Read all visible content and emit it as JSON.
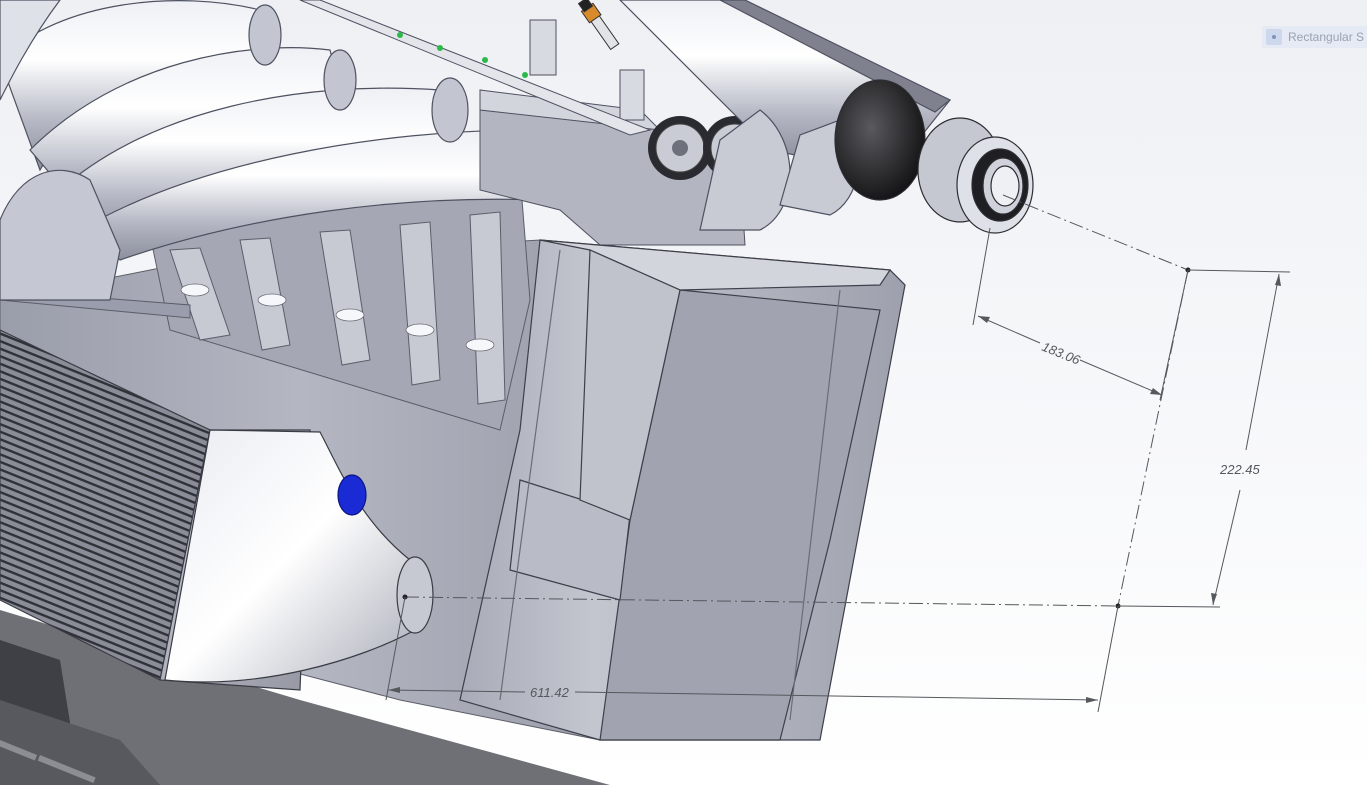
{
  "toolbar_hint": {
    "label": "Rectangular S",
    "icon": "sketch-entity-icon"
  },
  "dimensions": {
    "horizontal": "611.42",
    "angled": "183.06",
    "vertical": "222.45"
  },
  "colors": {
    "background": "#f3f4f7",
    "metal": "#b7bac4",
    "dimension_line": "#55585c",
    "accent_blue": "#1a2bd6",
    "injector_orange": "#d98a2a"
  }
}
